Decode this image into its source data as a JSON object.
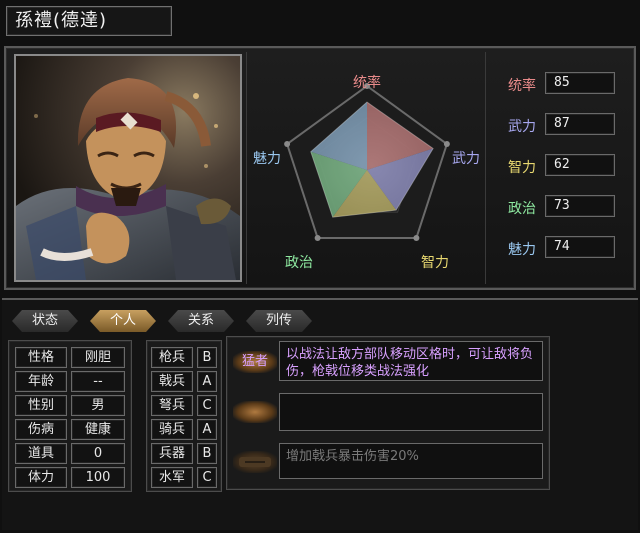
{
  "header": {
    "name": "孫禮(德達)"
  },
  "portrait": {
    "alt": "武将肖像"
  },
  "radar": {
    "labels": {
      "tongshuai": "统率",
      "wuli": "武力",
      "zhili": "智力",
      "zhengzhi": "政治",
      "meili": "魅力"
    },
    "levels": {
      "tongshuai": 0.85,
      "wuli": 0.87,
      "zhili": 0.62,
      "zhengzhi": 0.73,
      "meili": 0.74
    }
  },
  "stats": [
    {
      "label": "统率",
      "value": "85",
      "color": "#e88a8a"
    },
    {
      "label": "武力",
      "value": "87",
      "color": "#a8a8f0"
    },
    {
      "label": "智力",
      "value": "62",
      "color": "#e8d870"
    },
    {
      "label": "政治",
      "value": "73",
      "color": "#8ee8a0"
    },
    {
      "label": "魅力",
      "value": "74",
      "color": "#9ac8f0"
    }
  ],
  "tabs": [
    {
      "label": "状态",
      "active": false
    },
    {
      "label": "个人",
      "active": true
    },
    {
      "label": "关系",
      "active": false
    },
    {
      "label": "列传",
      "active": false
    }
  ],
  "profile": [
    {
      "label": "性格",
      "value": "刚胆"
    },
    {
      "label": "年龄",
      "value": "--"
    },
    {
      "label": "性别",
      "value": "男"
    },
    {
      "label": "伤病",
      "value": "健康"
    },
    {
      "label": "道具",
      "value": "0"
    },
    {
      "label": "体力",
      "value": "100"
    }
  ],
  "aptitude": [
    {
      "label": "枪兵",
      "grade": "B"
    },
    {
      "label": "戟兵",
      "grade": "A"
    },
    {
      "label": "弩兵",
      "grade": "C"
    },
    {
      "label": "骑兵",
      "grade": "A"
    },
    {
      "label": "兵器",
      "grade": "B"
    },
    {
      "label": "水军",
      "grade": "C"
    }
  ],
  "skills": [
    {
      "name": "猛者",
      "desc": "以战法让敌方部队移动区格时，可让敌将负伤，枪戟位移类战法强化",
      "active": true
    },
    {
      "name": "",
      "desc": "",
      "active": false
    },
    {
      "name": "",
      "desc": "增加戟兵暴击伤害20%",
      "active": false
    }
  ],
  "colors": {
    "accent": "#c8a060",
    "skill_text": "#d8a0ff",
    "disabled_text": "#7a7a7a",
    "panel_border": "#5a5a5a"
  }
}
